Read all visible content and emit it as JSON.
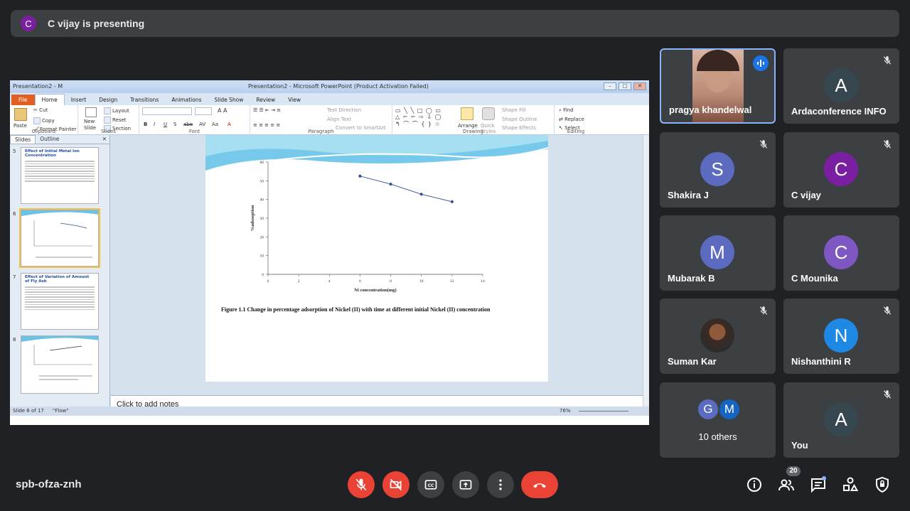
{
  "banner": {
    "avatar_letter": "C",
    "text": "C vijay is presenting"
  },
  "powerpoint": {
    "app_left": "Presentation2 - M",
    "window_title": "Presentation2 - Microsoft PowerPoint (Product Activation Failed)",
    "tabs": [
      "File",
      "Home",
      "Insert",
      "Design",
      "Transitions",
      "Animations",
      "Slide Show",
      "Review",
      "View"
    ],
    "ribbon": {
      "paste": "Paste",
      "cut": "Cut",
      "copy": "Copy",
      "format_painter": "Format Painter",
      "clipboard": "Clipboard",
      "new_slide": "New Slide",
      "layout": "Layout",
      "reset": "Reset",
      "section": "Section",
      "slides": "Slides",
      "font": "Font",
      "paragraph": "Paragraph",
      "text_direction": "Text Direction",
      "align_text": "Align Text",
      "convert_smartart": "Convert to SmartArt",
      "arrange": "Arrange",
      "quick_styles": "Quick Styles",
      "shape_fill": "Shape Fill",
      "shape_outline": "Shape Outline",
      "shape_effects": "Shape Effects",
      "drawing": "Drawing",
      "find": "Find",
      "replace": "Replace",
      "select": "Select",
      "editing": "Editing"
    },
    "panel_tabs": [
      "Slides",
      "Outline"
    ],
    "thumbs": [
      {
        "num": "5",
        "title": "Effect of Initial Metal Ion Concentration"
      },
      {
        "num": "6",
        "title": ""
      },
      {
        "num": "7",
        "title": "Effect of Variation of Amount of Fly Ash"
      },
      {
        "num": "8",
        "title": ""
      }
    ],
    "notes_placeholder": "Click to add notes",
    "status_slide": "Slide 6 of 17",
    "status_theme": "\"Flow\"",
    "zoom": "76%"
  },
  "chart_data": {
    "type": "line",
    "x": [
      6,
      8,
      10,
      12
    ],
    "values": [
      52.5,
      48.2,
      42.8,
      38.8
    ],
    "xlim": [
      0,
      14
    ],
    "ylim": [
      0,
      60
    ],
    "xticks": [
      "0",
      "2",
      "4",
      "6",
      "8",
      "10",
      "12",
      "14"
    ],
    "yticks": [
      "0",
      "10",
      "20",
      "30",
      "40",
      "50",
      "60"
    ],
    "xlabel": "Ni concentration(mg)",
    "ylabel": "%adsorption",
    "caption": "Figure 1.1 Change in percentage adsorption of Nickel (II) with time at different initial Nickel (II) concentration",
    "grid": false,
    "series_color": "#2f4f8f"
  },
  "participants": [
    {
      "name": "pragya khandelwal",
      "kind": "video",
      "speaking": true
    },
    {
      "name": "Ardaconference INFO",
      "letter": "A",
      "color": "#37474f",
      "muted": true
    },
    {
      "name": "Shakira J",
      "letter": "S",
      "color": "#5c6bc0",
      "muted": true
    },
    {
      "name": "C vijay",
      "letter": "C",
      "color": "#7b1fa2",
      "muted": true
    },
    {
      "name": "Mubarak B",
      "letter": "M",
      "color": "#5c6bc0",
      "muted": false
    },
    {
      "name": "C Mounika",
      "letter": "C",
      "color": "#7e57c2",
      "muted": false
    },
    {
      "name": "Suman Kar",
      "kind": "photo",
      "muted": true
    },
    {
      "name": "Nishanthini R",
      "letter": "N",
      "color": "#1e88e5",
      "muted": true
    },
    {
      "name": "10 others",
      "kind": "others",
      "letters": [
        "G",
        "M"
      ],
      "colors": [
        "#5c6bc0",
        "#1565c0"
      ]
    },
    {
      "name": "You",
      "letter": "A",
      "color": "#37474f",
      "muted": true
    }
  ],
  "meeting": {
    "code": "spb-ofza-znh",
    "people_count": "20"
  }
}
